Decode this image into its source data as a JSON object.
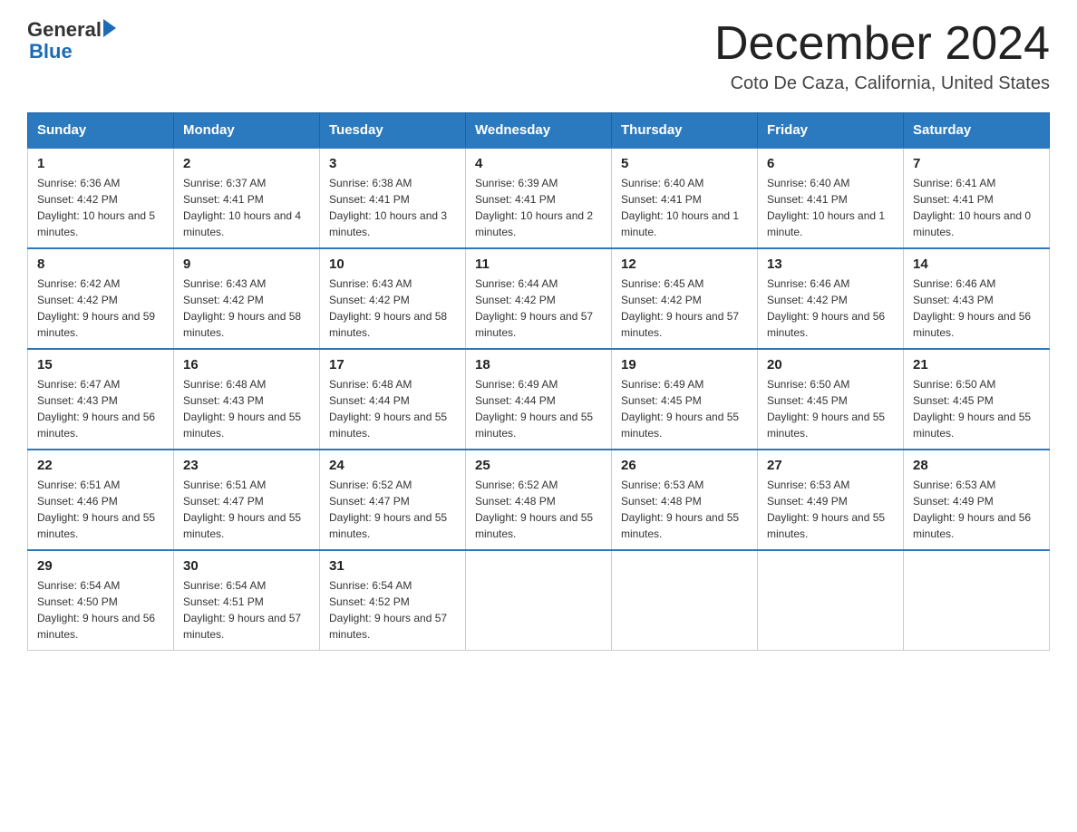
{
  "header": {
    "logo_general": "General",
    "logo_blue": "Blue",
    "month_title": "December 2024",
    "location": "Coto De Caza, California, United States"
  },
  "days_of_week": [
    "Sunday",
    "Monday",
    "Tuesday",
    "Wednesday",
    "Thursday",
    "Friday",
    "Saturday"
  ],
  "weeks": [
    [
      {
        "day": "1",
        "sunrise": "6:36 AM",
        "sunset": "4:42 PM",
        "daylight": "10 hours and 5 minutes."
      },
      {
        "day": "2",
        "sunrise": "6:37 AM",
        "sunset": "4:41 PM",
        "daylight": "10 hours and 4 minutes."
      },
      {
        "day": "3",
        "sunrise": "6:38 AM",
        "sunset": "4:41 PM",
        "daylight": "10 hours and 3 minutes."
      },
      {
        "day": "4",
        "sunrise": "6:39 AM",
        "sunset": "4:41 PM",
        "daylight": "10 hours and 2 minutes."
      },
      {
        "day": "5",
        "sunrise": "6:40 AM",
        "sunset": "4:41 PM",
        "daylight": "10 hours and 1 minute."
      },
      {
        "day": "6",
        "sunrise": "6:40 AM",
        "sunset": "4:41 PM",
        "daylight": "10 hours and 1 minute."
      },
      {
        "day": "7",
        "sunrise": "6:41 AM",
        "sunset": "4:41 PM",
        "daylight": "10 hours and 0 minutes."
      }
    ],
    [
      {
        "day": "8",
        "sunrise": "6:42 AM",
        "sunset": "4:42 PM",
        "daylight": "9 hours and 59 minutes."
      },
      {
        "day": "9",
        "sunrise": "6:43 AM",
        "sunset": "4:42 PM",
        "daylight": "9 hours and 58 minutes."
      },
      {
        "day": "10",
        "sunrise": "6:43 AM",
        "sunset": "4:42 PM",
        "daylight": "9 hours and 58 minutes."
      },
      {
        "day": "11",
        "sunrise": "6:44 AM",
        "sunset": "4:42 PM",
        "daylight": "9 hours and 57 minutes."
      },
      {
        "day": "12",
        "sunrise": "6:45 AM",
        "sunset": "4:42 PM",
        "daylight": "9 hours and 57 minutes."
      },
      {
        "day": "13",
        "sunrise": "6:46 AM",
        "sunset": "4:42 PM",
        "daylight": "9 hours and 56 minutes."
      },
      {
        "day": "14",
        "sunrise": "6:46 AM",
        "sunset": "4:43 PM",
        "daylight": "9 hours and 56 minutes."
      }
    ],
    [
      {
        "day": "15",
        "sunrise": "6:47 AM",
        "sunset": "4:43 PM",
        "daylight": "9 hours and 56 minutes."
      },
      {
        "day": "16",
        "sunrise": "6:48 AM",
        "sunset": "4:43 PM",
        "daylight": "9 hours and 55 minutes."
      },
      {
        "day": "17",
        "sunrise": "6:48 AM",
        "sunset": "4:44 PM",
        "daylight": "9 hours and 55 minutes."
      },
      {
        "day": "18",
        "sunrise": "6:49 AM",
        "sunset": "4:44 PM",
        "daylight": "9 hours and 55 minutes."
      },
      {
        "day": "19",
        "sunrise": "6:49 AM",
        "sunset": "4:45 PM",
        "daylight": "9 hours and 55 minutes."
      },
      {
        "day": "20",
        "sunrise": "6:50 AM",
        "sunset": "4:45 PM",
        "daylight": "9 hours and 55 minutes."
      },
      {
        "day": "21",
        "sunrise": "6:50 AM",
        "sunset": "4:45 PM",
        "daylight": "9 hours and 55 minutes."
      }
    ],
    [
      {
        "day": "22",
        "sunrise": "6:51 AM",
        "sunset": "4:46 PM",
        "daylight": "9 hours and 55 minutes."
      },
      {
        "day": "23",
        "sunrise": "6:51 AM",
        "sunset": "4:47 PM",
        "daylight": "9 hours and 55 minutes."
      },
      {
        "day": "24",
        "sunrise": "6:52 AM",
        "sunset": "4:47 PM",
        "daylight": "9 hours and 55 minutes."
      },
      {
        "day": "25",
        "sunrise": "6:52 AM",
        "sunset": "4:48 PM",
        "daylight": "9 hours and 55 minutes."
      },
      {
        "day": "26",
        "sunrise": "6:53 AM",
        "sunset": "4:48 PM",
        "daylight": "9 hours and 55 minutes."
      },
      {
        "day": "27",
        "sunrise": "6:53 AM",
        "sunset": "4:49 PM",
        "daylight": "9 hours and 55 minutes."
      },
      {
        "day": "28",
        "sunrise": "6:53 AM",
        "sunset": "4:49 PM",
        "daylight": "9 hours and 56 minutes."
      }
    ],
    [
      {
        "day": "29",
        "sunrise": "6:54 AM",
        "sunset": "4:50 PM",
        "daylight": "9 hours and 56 minutes."
      },
      {
        "day": "30",
        "sunrise": "6:54 AM",
        "sunset": "4:51 PM",
        "daylight": "9 hours and 57 minutes."
      },
      {
        "day": "31",
        "sunrise": "6:54 AM",
        "sunset": "4:52 PM",
        "daylight": "9 hours and 57 minutes."
      },
      null,
      null,
      null,
      null
    ]
  ]
}
